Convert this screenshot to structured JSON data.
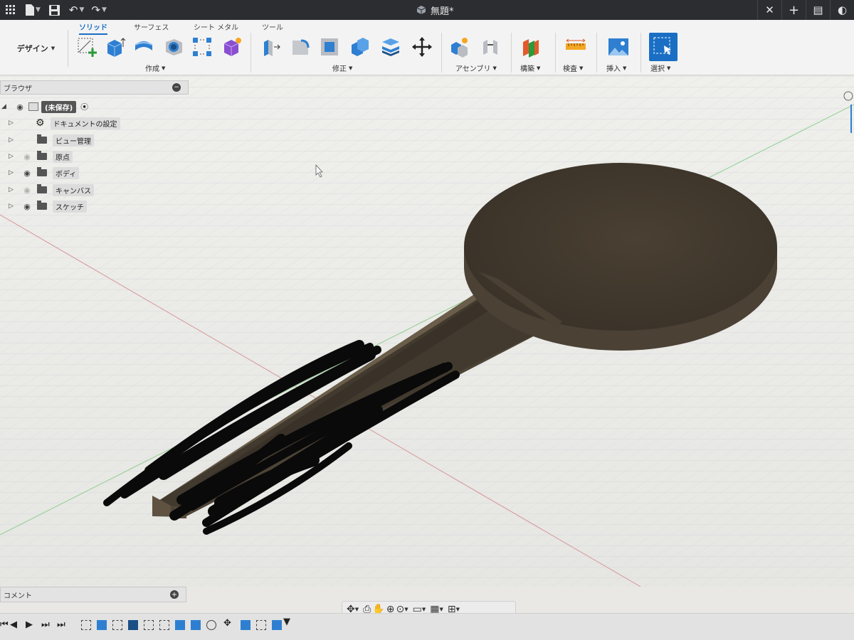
{
  "titlebar": {
    "document_title": "無題*",
    "left_icons": [
      "grid-menu-icon",
      "file-icon",
      "save-icon",
      "undo-icon",
      "redo-icon"
    ],
    "right_icons": [
      "close-tab-icon",
      "new-tab-icon",
      "notifications-icon",
      "account-icon"
    ]
  },
  "toolbar": {
    "workspace": "デザイン",
    "tabs": [
      {
        "label": "ソリッド",
        "active": true
      },
      {
        "label": "サーフェス",
        "active": false
      },
      {
        "label": "シート メタル",
        "active": false
      },
      {
        "label": "ツール",
        "active": false
      }
    ],
    "groups": [
      {
        "label": "作成"
      },
      {
        "label": "修正"
      },
      {
        "label": "アセンブリ"
      },
      {
        "label": "構築"
      },
      {
        "label": "検査"
      },
      {
        "label": "挿入"
      },
      {
        "label": "選択"
      }
    ]
  },
  "browser": {
    "title": "ブラウザ",
    "root_label": "(未保存)",
    "items": [
      {
        "label": "ドキュメントの設定",
        "icon": "gear-icon",
        "visible": null
      },
      {
        "label": "ビュー管理",
        "icon": "folder-icon",
        "visible": null
      },
      {
        "label": "原点",
        "icon": "folder-icon",
        "visible": false
      },
      {
        "label": "ボディ",
        "icon": "folder-icon",
        "visible": true
      },
      {
        "label": "キャンバス",
        "icon": "folder-icon",
        "visible": false
      },
      {
        "label": "スケッチ",
        "icon": "folder-icon",
        "visible": true
      }
    ]
  },
  "comments": {
    "title": "コメント"
  },
  "colors": {
    "accent": "#1a6fc4",
    "model_body": "#4a4033",
    "model_top": "#3f372b",
    "grid_line": "#c9ccd3",
    "axis_red": "#d08080",
    "axis_green": "#7fc07f"
  }
}
